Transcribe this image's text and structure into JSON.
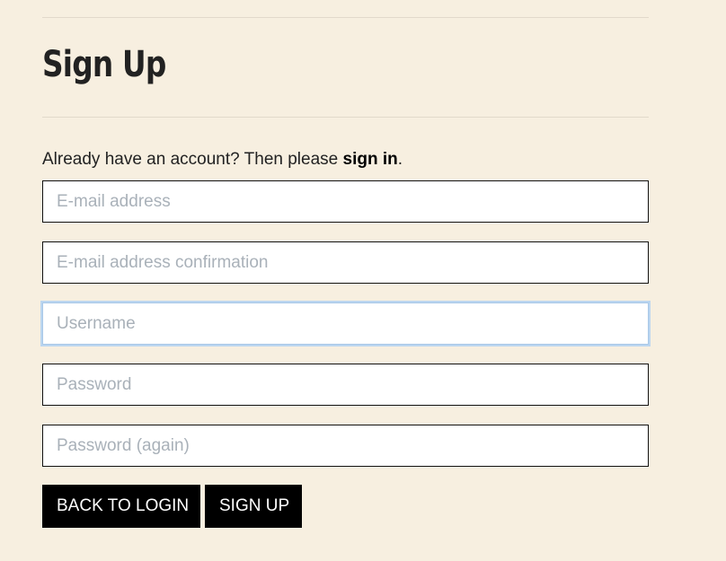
{
  "heading": "Sign Up",
  "intro": {
    "text": "Already have an account? Then please ",
    "link": "sign in",
    "suffix": "."
  },
  "form": {
    "email_placeholder": "E-mail address",
    "email_confirm_placeholder": "E-mail address confirmation",
    "username_placeholder": "Username",
    "password_placeholder": "Password",
    "password_again_placeholder": "Password (again)",
    "focused_field": "username"
  },
  "buttons": {
    "back_label": "BACK TO LOGIN",
    "signup_label": "SIGN UP"
  },
  "colors": {
    "background": "#f7efe0",
    "button": "#000000",
    "focus_ring": "#bcd6ef"
  }
}
